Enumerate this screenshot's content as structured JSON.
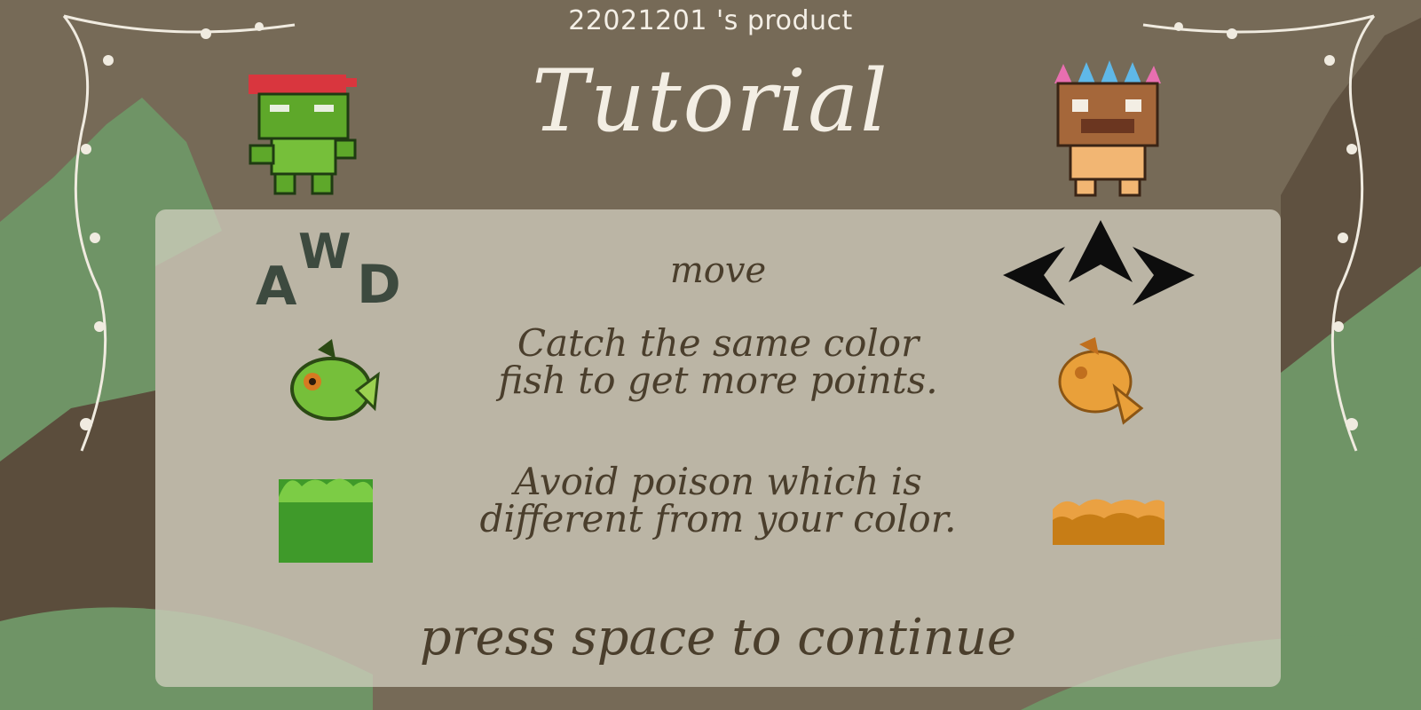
{
  "header": {
    "credit": "22021201 's product",
    "title": "Tutorial"
  },
  "instructions": {
    "move": "move",
    "catch_line1": "Catch the same color",
    "catch_line2": "fish to get more points.",
    "avoid_line1": "Avoid poison which is",
    "avoid_line2": "different from your color.",
    "continue": "press space to continue"
  },
  "keys": {
    "left_key": "A",
    "up_key": "W",
    "right_key": "D"
  },
  "characters": {
    "player1": "frog-ninja-sprite",
    "player2": "tiki-mask-sprite"
  },
  "colors": {
    "player1": "#5ea82a",
    "player2": "#e9a03a",
    "text": "#4a3e2c",
    "background": "#766a57",
    "mountain": "#6f9466"
  }
}
